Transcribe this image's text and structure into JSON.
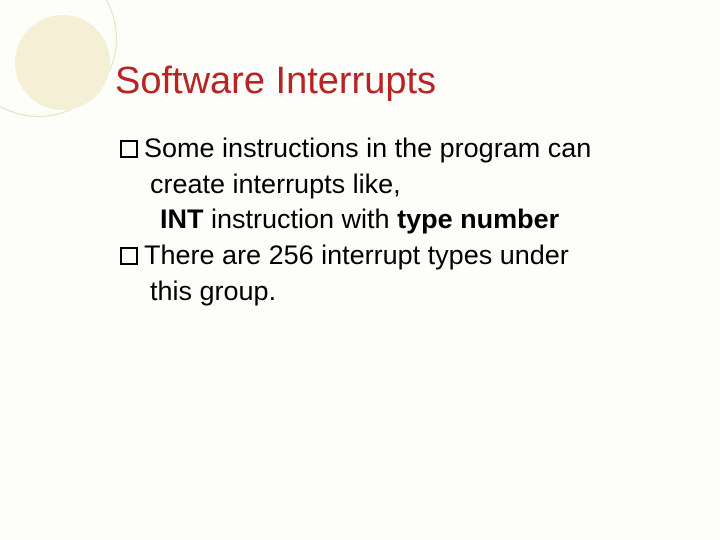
{
  "slide": {
    "title": "Software Interrupts",
    "bullets": [
      {
        "lead_word": "Some",
        "rest_line1": " instructions in the program can",
        "line2": "create interrupts like,",
        "line3_prefix": "INT",
        "line3_mid": " instruction with ",
        "line3_suffix": "type number"
      },
      {
        "lead_word": "There",
        "rest_line1": " are 256 interrupt types under",
        "line2": "this group."
      }
    ]
  }
}
